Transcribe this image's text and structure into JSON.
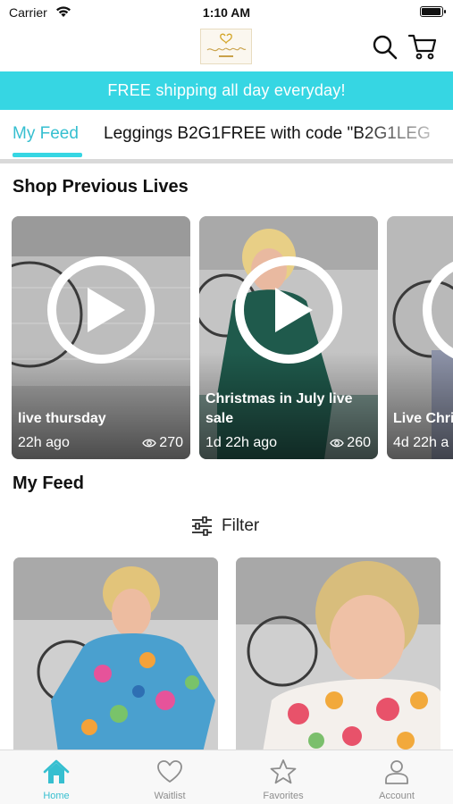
{
  "status_bar": {
    "carrier": "Carrier",
    "time": "1:10 AM",
    "battery_level": 0.95
  },
  "header": {
    "logo_icon": "brand-logo",
    "search_icon": "search-icon",
    "cart_icon": "cart-icon"
  },
  "banner": {
    "text": "FREE shipping all day everyday!",
    "color": "#36d6e3"
  },
  "tabs": [
    {
      "label": "My Feed",
      "active": true
    },
    {
      "label": "Leggings B2G1FREE with code \"B2G1LEG",
      "active": false
    }
  ],
  "sections": {
    "previous_lives": "Shop Previous Lives",
    "my_feed": "My Feed"
  },
  "lives": [
    {
      "title": "live thursday",
      "age": "22h ago",
      "views": "270"
    },
    {
      "title": "Christmas in July live sale",
      "age": "1d 22h ago",
      "views": "260"
    },
    {
      "title": "Live Chri",
      "age": "4d 22h a",
      "views": ""
    }
  ],
  "filter": {
    "label": "Filter",
    "icon": "sliders-icon"
  },
  "tabbar": {
    "items": [
      {
        "label": "Home",
        "icon": "home-icon",
        "active": true
      },
      {
        "label": "Waitlist",
        "icon": "heart-icon",
        "active": false
      },
      {
        "label": "Favorites",
        "icon": "star-icon",
        "active": false
      },
      {
        "label": "Account",
        "icon": "account-icon",
        "active": false
      }
    ]
  },
  "colors": {
    "accent": "#36d6e3",
    "accent_text": "#36bfd0",
    "inactive": "#8e8e8e"
  }
}
